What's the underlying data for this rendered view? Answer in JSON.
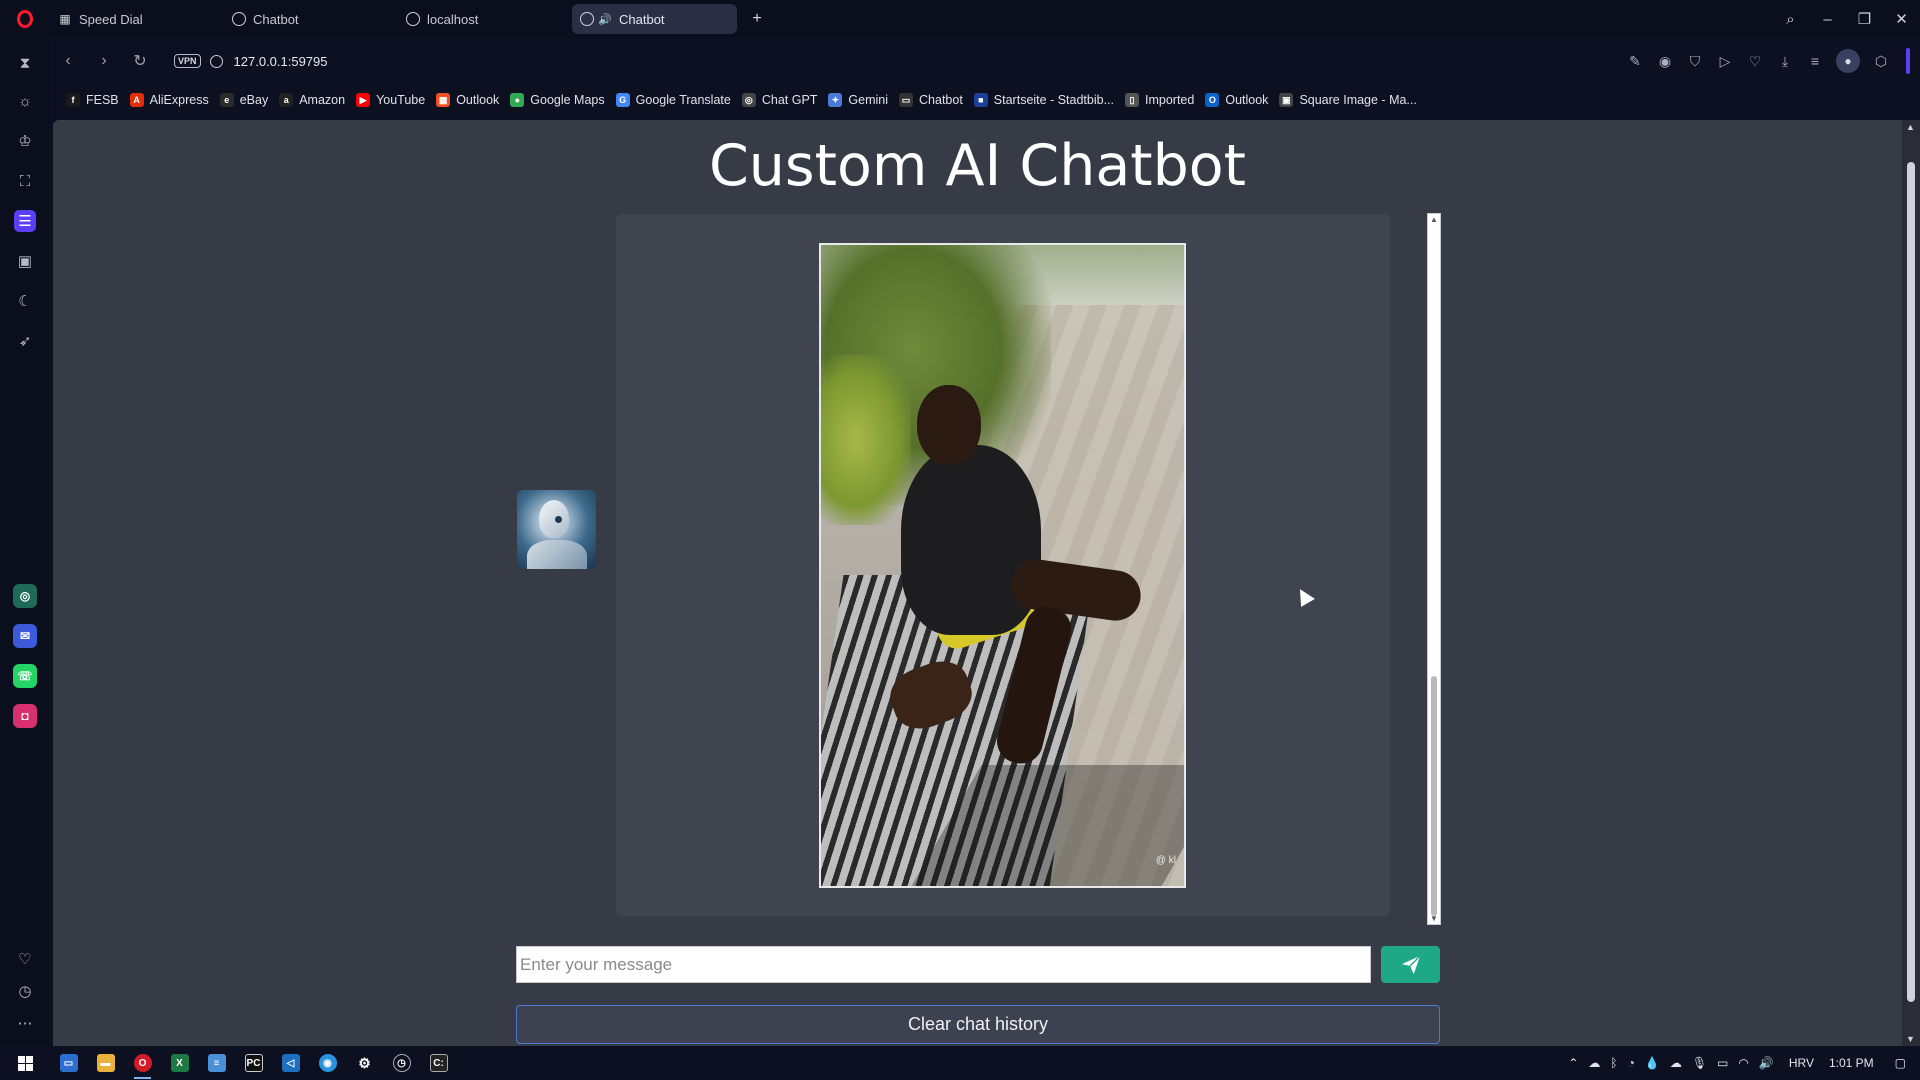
{
  "browser": {
    "tabs": [
      {
        "label": "Speed Dial",
        "icon": "grid-icon",
        "active": false
      },
      {
        "label": "Chatbot",
        "icon": "globe-icon",
        "active": false
      },
      {
        "label": "localhost",
        "icon": "globe-icon",
        "active": false
      },
      {
        "label": "Chatbot",
        "icon": "globe-icon",
        "active": true
      }
    ],
    "url": "127.0.0.1:59795",
    "vpn_badge": "VPN",
    "bookmarks": [
      {
        "label": "FESB",
        "icon": "f",
        "color": "#1a1a1a"
      },
      {
        "label": "AliExpress",
        "icon": "A",
        "color": "#e62e04"
      },
      {
        "label": "eBay",
        "icon": "e",
        "color": "#2a2a2a"
      },
      {
        "label": "Amazon",
        "icon": "a",
        "color": "#222222"
      },
      {
        "label": "YouTube",
        "icon": "▶",
        "color": "#ff0000"
      },
      {
        "label": "Outlook",
        "icon": "▦",
        "color": "#f25022"
      },
      {
        "label": "Google Maps",
        "icon": "●",
        "color": "#34a853"
      },
      {
        "label": "Google Translate",
        "icon": "G",
        "color": "#4285f4"
      },
      {
        "label": "Chat GPT",
        "icon": "◎",
        "color": "#444444"
      },
      {
        "label": "Gemini",
        "icon": "✦",
        "color": "#4a7bd8"
      },
      {
        "label": "Chatbot",
        "icon": "▭",
        "color": "#333333"
      },
      {
        "label": "Startseite - Stadtbib...",
        "icon": "■",
        "color": "#1b3f9c"
      },
      {
        "label": "Imported",
        "icon": "▯",
        "color": "#555555"
      },
      {
        "label": "Outlook",
        "icon": "O",
        "color": "#0a64c8"
      },
      {
        "label": "Square Image - Ma...",
        "icon": "▣",
        "color": "#444444"
      }
    ]
  },
  "page": {
    "title": "Custom AI Chatbot",
    "input_placeholder": "Enter your message",
    "input_value": "",
    "send_icon": "paper-plane-icon",
    "clear_label": "Clear chat history",
    "video_watermark": "@ kl"
  },
  "taskbar": {
    "lang": "HRV",
    "time": "1:01 PM"
  },
  "colors": {
    "accent": "#5b3ff7",
    "send_button": "#1fa885",
    "page_bg": "#373b46",
    "chat_panel": "#40444f"
  }
}
